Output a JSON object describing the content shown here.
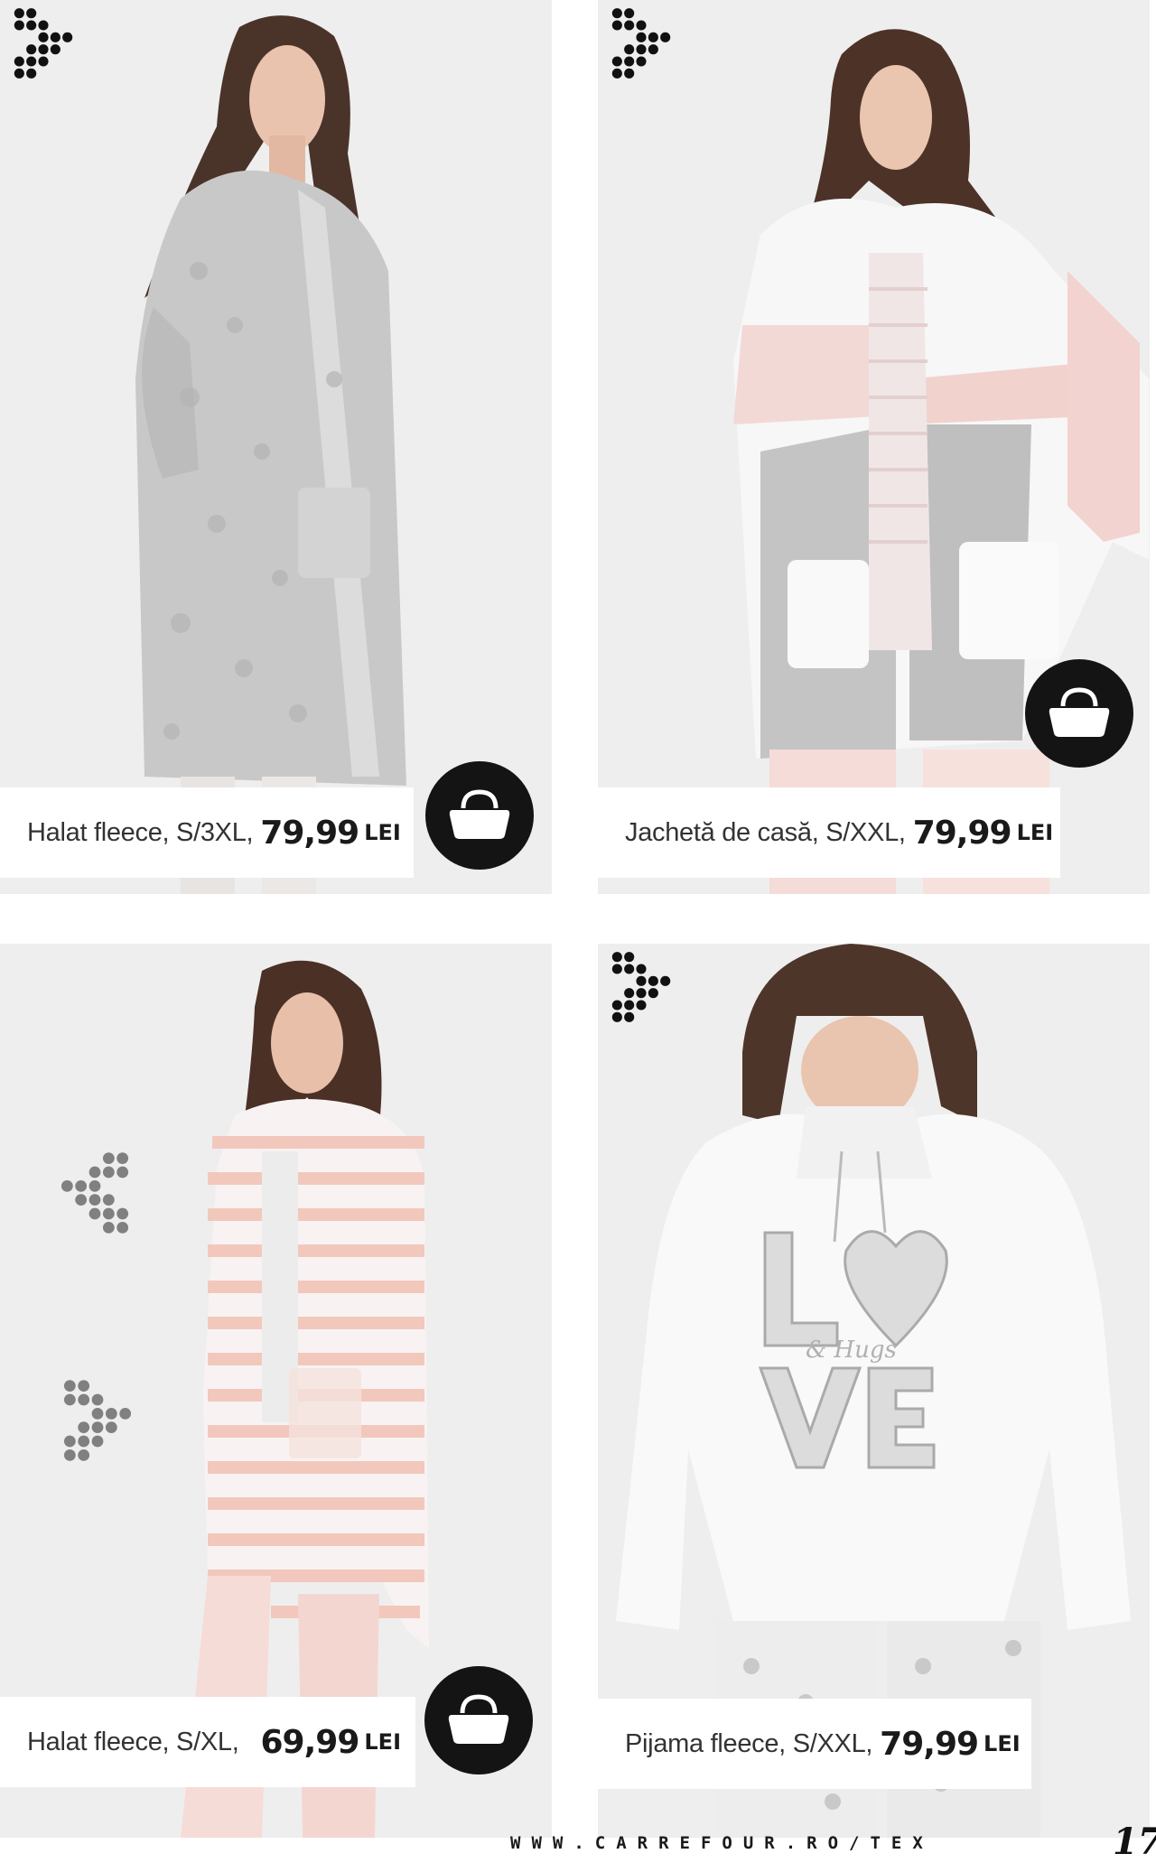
{
  "products": [
    {
      "name": "Halat fleece, S/3XL,",
      "price": "79,99",
      "currency": "LEI",
      "image": "woman-grey-leopard-fleece-robe"
    },
    {
      "name": "Jachetă de casă, S/XXL,",
      "price": "79,99",
      "currency": "LEI",
      "image": "woman-pink-grey-white-fleece-jacket"
    },
    {
      "name": "Halat fleece, S/XL,",
      "price": "69,99",
      "currency": "LEI",
      "image": "woman-pink-striped-fleece-robe"
    },
    {
      "name": "Pijama fleece, S/XXL,",
      "price": "79,99",
      "currency": "LEI",
      "image": "woman-white-love-hugs-pyjama"
    }
  ],
  "icons": {
    "bag": "shopping-bag-icon",
    "arrow": "dotted-chevron-right-icon",
    "arrow_left": "dotted-chevron-left-icon"
  },
  "colors": {
    "background": "#f0efef",
    "bag_button": "#141414",
    "label_bg": "#ffffff",
    "decor_grey": "#808080"
  },
  "footer": {
    "url": "WWW.CARREFOUR.RO/TEX",
    "page_number": "17"
  }
}
